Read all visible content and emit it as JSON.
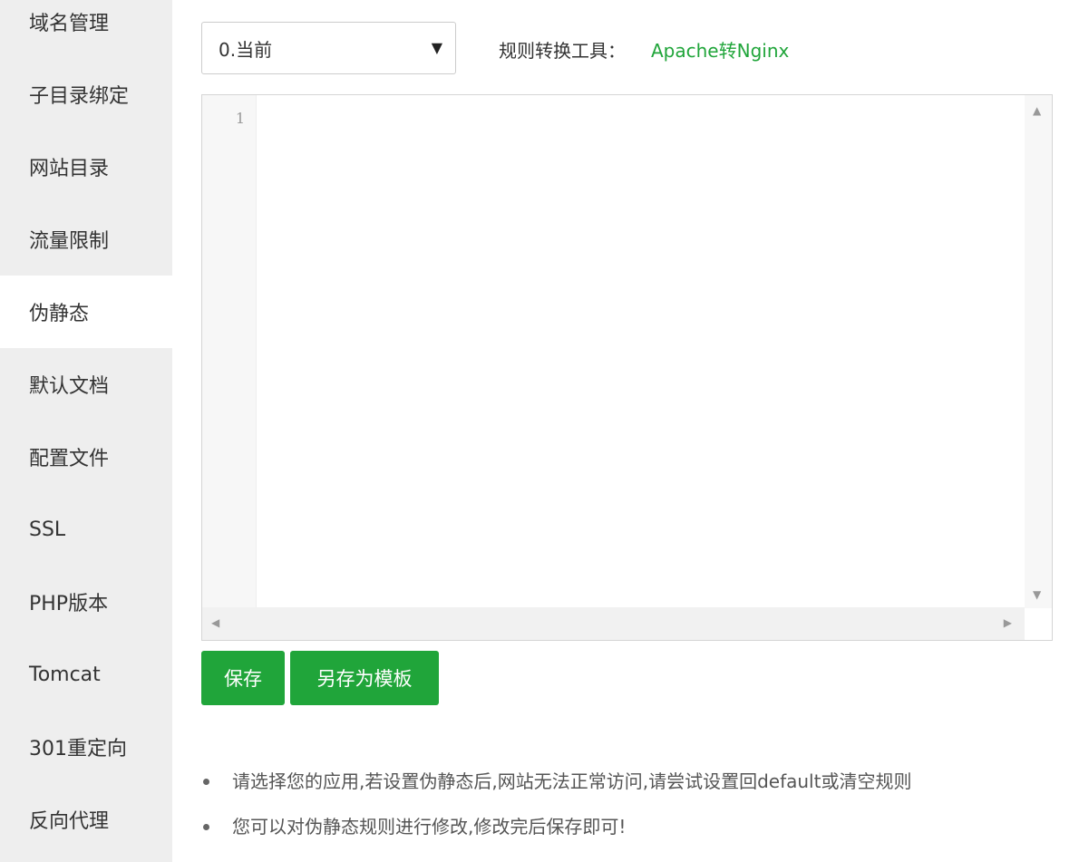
{
  "sidebar": {
    "items": [
      {
        "label": "域名管理",
        "active": false
      },
      {
        "label": "子目录绑定",
        "active": false
      },
      {
        "label": "网站目录",
        "active": false
      },
      {
        "label": "流量限制",
        "active": false
      },
      {
        "label": "伪静态",
        "active": true
      },
      {
        "label": "默认文档",
        "active": false
      },
      {
        "label": "配置文件",
        "active": false
      },
      {
        "label": "SSL",
        "active": false
      },
      {
        "label": "PHP版本",
        "active": false
      },
      {
        "label": "Tomcat",
        "active": false
      },
      {
        "label": "301重定向",
        "active": false
      },
      {
        "label": "反向代理",
        "active": false
      }
    ]
  },
  "rule_select": {
    "value": "0.当前",
    "caret": "▼"
  },
  "converter": {
    "label": "规则转换工具：",
    "link": "Apache转Nginx"
  },
  "editor": {
    "line_numbers": [
      "1"
    ],
    "content": ""
  },
  "buttons": {
    "save": "保存",
    "save_as_template": "另存为模板"
  },
  "tips": [
    "请选择您的应用,若设置伪静态后,网站无法正常访问,请尝试设置回default或清空规则",
    "您可以对伪静态规则进行修改,修改完后保存即可!"
  ],
  "colors": {
    "accent": "#20a53a",
    "sidebar_bg": "#eeeeee"
  }
}
